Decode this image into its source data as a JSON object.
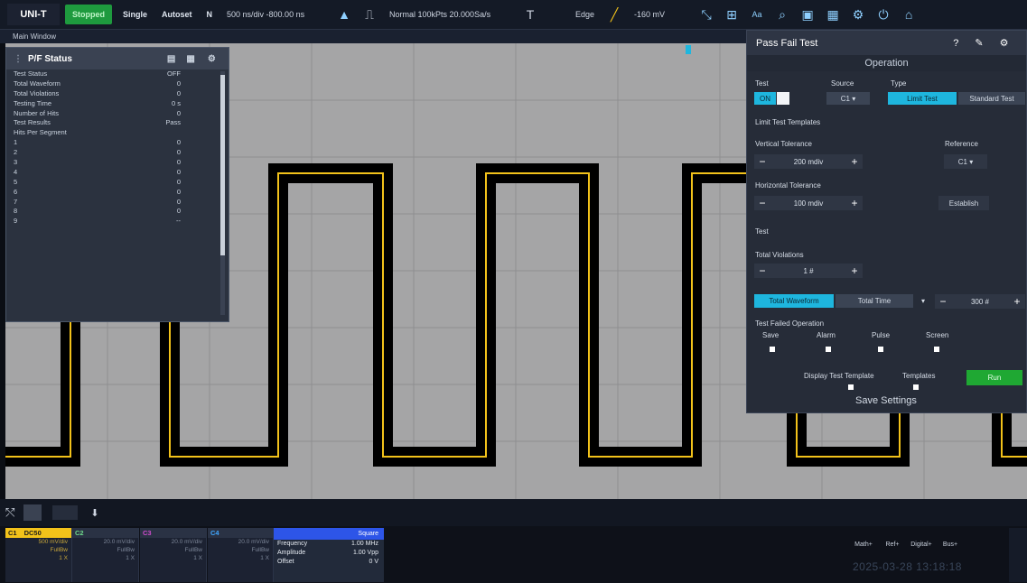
{
  "topbar": {
    "logo": "UNI-T",
    "run_state": "Stopped",
    "single": "Single",
    "autoset": "Autoset",
    "mode": "N",
    "timebase": "500 ns/div   -800.00 ns",
    "trig_mode": "Normal  100kPts  20.000Sa/s",
    "trigger": "Edge",
    "trig_level": "-160 mV"
  },
  "main_window_label": "Main Window",
  "pf_status": {
    "title": "P/F Status",
    "rows": [
      {
        "label": "Test Status",
        "value": "OFF"
      },
      {
        "label": "Total Waveform",
        "value": "0"
      },
      {
        "label": "Total Violations",
        "value": "0"
      },
      {
        "label": "Testing Time",
        "value": "0 s"
      },
      {
        "label": "Number of Hits",
        "value": "0"
      },
      {
        "label": "Test Results",
        "value": "Pass"
      },
      {
        "label": "Hits Per Segment",
        "value": ""
      },
      {
        "label": "1",
        "value": "0"
      },
      {
        "label": "2",
        "value": "0"
      },
      {
        "label": "3",
        "value": "0"
      },
      {
        "label": "4",
        "value": "0"
      },
      {
        "label": "5",
        "value": "0"
      },
      {
        "label": "6",
        "value": "0"
      },
      {
        "label": "7",
        "value": "0"
      },
      {
        "label": "8",
        "value": "0"
      },
      {
        "label": "9",
        "value": "--"
      }
    ]
  },
  "pass_fail": {
    "title": "Pass Fail Test",
    "tab": "Operation",
    "test_label": "Test",
    "test_on": "ON",
    "source_label": "Source",
    "source_value": "C1",
    "type_label": "Type",
    "type_limit": "Limit Test",
    "type_standard": "Standard Test",
    "templates_label": "Limit Test Templates",
    "vt_label": "Vertical Tolerance",
    "vt_value": "200 mdiv",
    "ref_label": "Reference",
    "ref_value": "C1",
    "ht_label": "Horizontal Tolerance",
    "ht_value": "100 mdiv",
    "establish": "Establish",
    "test_section": "Test",
    "tv_label": "Total Violations",
    "tv_value": "1 #",
    "total_waveform": "Total Waveform",
    "total_time": "Total Time",
    "tw_value": "300 #",
    "fail_label": "Test Failed Operation",
    "save": "Save",
    "alarm": "Alarm",
    "pulse": "Pulse",
    "screen": "Screen",
    "display_template": "Display Test Template",
    "templates": "Templates",
    "run": "Run",
    "save_settings": "Save Settings"
  },
  "channels": [
    {
      "name": "C1",
      "coupling": "DC50",
      "scale": "500 mV/div",
      "bw": "FullBw",
      "probe": "1 X",
      "color": "#f2c21a"
    },
    {
      "name": "C2",
      "coupling": "",
      "scale": "20.0 mV/div",
      "bw": "FullBw",
      "probe": "1 X",
      "color": "#6fdc8c"
    },
    {
      "name": "C3",
      "coupling": "",
      "scale": "20.0 mV/div",
      "bw": "FullBw",
      "probe": "1 X",
      "color": "#d04ccf"
    },
    {
      "name": "C4",
      "coupling": "",
      "scale": "20.0 mV/div",
      "bw": "FullBw",
      "probe": "1 X",
      "color": "#3fa7ff"
    }
  ],
  "generator": {
    "wave": "Square",
    "rows": [
      {
        "label": "Frequency",
        "value": "1.00 MHz"
      },
      {
        "label": "Amplitude",
        "value": "1.00 Vpp"
      },
      {
        "label": "Offset",
        "value": "0 V"
      }
    ]
  },
  "right_buttons": [
    "Math+",
    "Ref+",
    "Digital+",
    "Bus+"
  ],
  "datetime": "2025-03-28 13:18:18",
  "colors": {
    "trace": "#f2c21a",
    "accent": "#1eb6de",
    "run": "#1fa833"
  }
}
